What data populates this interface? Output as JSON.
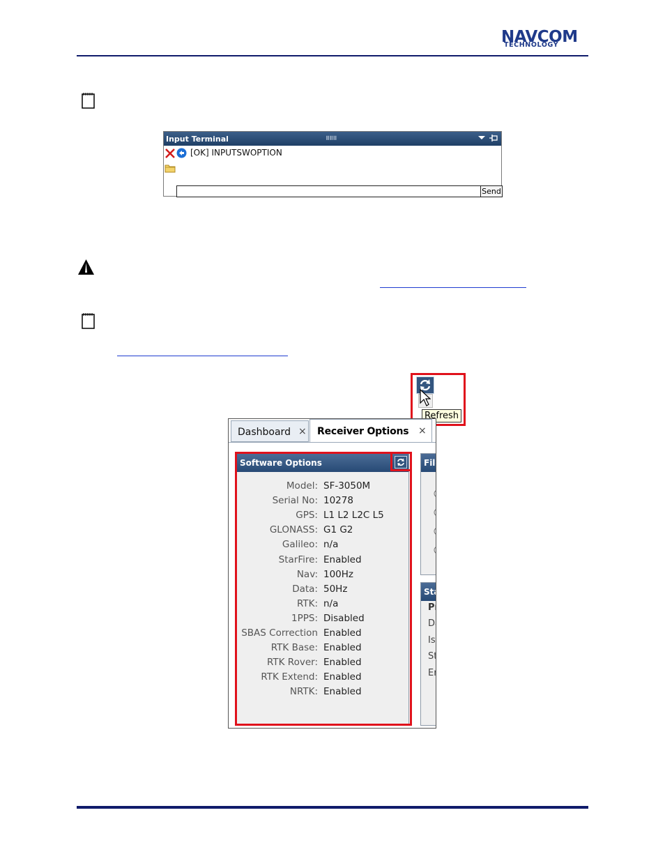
{
  "header": {
    "logo_main": "NAVCOM",
    "logo_sub": "TECHNOLOGY"
  },
  "terminal": {
    "title": "Input Terminal",
    "log_line": "[OK] INPUTSWOPTION",
    "send_label": "Send"
  },
  "app": {
    "tabs": [
      {
        "label": "Dashboard",
        "close": "×"
      },
      {
        "label": "Receiver Options",
        "close": "×"
      }
    ],
    "software_options": {
      "title": "Software Options",
      "rows": [
        {
          "key": "Model:",
          "value": "SF-3050M"
        },
        {
          "key": "Serial No:",
          "value": "10278"
        },
        {
          "key": "GPS:",
          "value": "L1 L2 L2C L5"
        },
        {
          "key": "GLONASS:",
          "value": "G1 G2"
        },
        {
          "key": "Galileo:",
          "value": "n/a"
        },
        {
          "key": "StarFire:",
          "value": "Enabled"
        },
        {
          "key": "Nav:",
          "value": "100Hz"
        },
        {
          "key": "Data:",
          "value": "50Hz"
        },
        {
          "key": "RTK:",
          "value": "n/a"
        },
        {
          "key": "1PPS:",
          "value": "Disabled"
        },
        {
          "key": "SBAS Correction",
          "value": "Enabled"
        },
        {
          "key": "RTK Base:",
          "value": "Enabled"
        },
        {
          "key": "RTK Rover:",
          "value": "Enabled"
        },
        {
          "key": "RTK Extend:",
          "value": "Enabled"
        },
        {
          "key": "NRTK:",
          "value": "Enabled"
        }
      ]
    },
    "side_panel_1_title": "File",
    "side_panel_2_title": "Sta",
    "side_panel_2_rows": [
      "Pr",
      "Da",
      "Is",
      "St",
      "Er"
    ]
  },
  "tooltip": {
    "label": "Refresh"
  },
  "colors": {
    "brand": "#1f3a8a",
    "rule": "#0f1b6b",
    "highlight": "#e0121c",
    "panel_header": "#274a75"
  },
  "icons": [
    "note-icon",
    "warning-icon",
    "delete-icon",
    "back-icon",
    "folder-icon",
    "refresh-icon",
    "cursor-icon"
  ]
}
